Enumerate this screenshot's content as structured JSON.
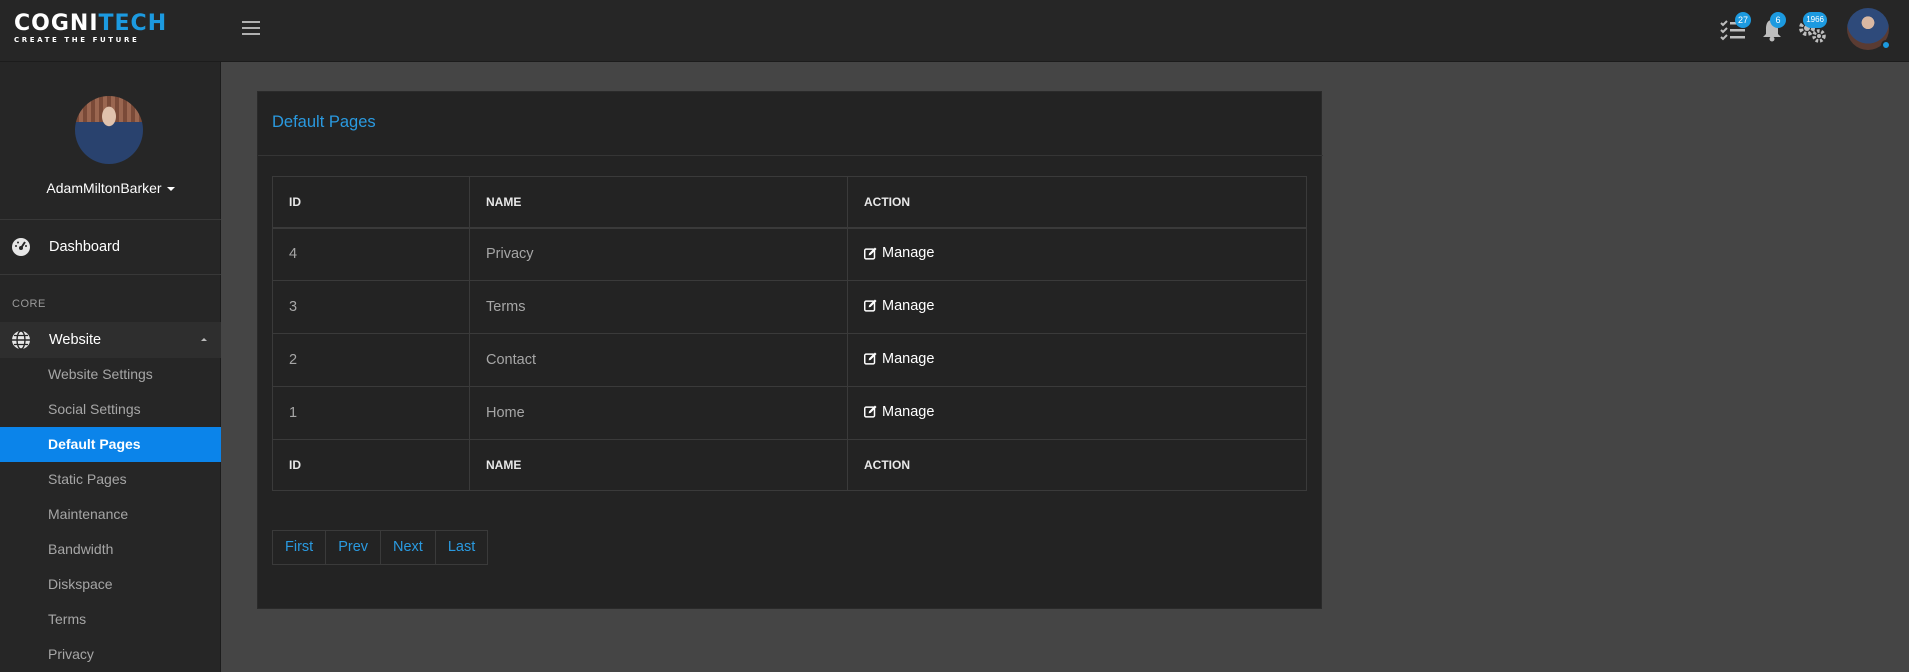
{
  "brand": {
    "name_main": "COGNI",
    "name_accent": "TECH",
    "tagline": "CREATE THE FUTURE",
    "accent_color": "#1c9ae0"
  },
  "topbar": {
    "tasks_icon": "checklist-icon",
    "tasks_count": "27",
    "notifications_icon": "bell-icon",
    "notifications_count": "6",
    "settings_icon": "gears-icon",
    "settings_count": "1966"
  },
  "sidebar": {
    "user_name": "AdamMiltonBarker",
    "dashboard_label": "Dashboard",
    "section_label": "CORE",
    "website_label": "Website",
    "items": [
      {
        "label": "Website Settings"
      },
      {
        "label": "Social Settings"
      },
      {
        "label": "Default Pages"
      },
      {
        "label": "Static Pages"
      },
      {
        "label": "Maintenance"
      },
      {
        "label": "Bandwidth"
      },
      {
        "label": "Diskspace"
      },
      {
        "label": "Terms"
      },
      {
        "label": "Privacy"
      }
    ],
    "active_color": "#0b84ea"
  },
  "card": {
    "title": "Default Pages",
    "columns": [
      "ID",
      "NAME",
      "ACTION"
    ],
    "rows": [
      {
        "id": "4",
        "name": "Privacy",
        "action": "Manage"
      },
      {
        "id": "3",
        "name": "Terms",
        "action": "Manage"
      },
      {
        "id": "2",
        "name": "Contact",
        "action": "Manage"
      },
      {
        "id": "1",
        "name": "Home",
        "action": "Manage"
      }
    ],
    "pagination": [
      "First",
      "Prev",
      "Next",
      "Last"
    ]
  }
}
